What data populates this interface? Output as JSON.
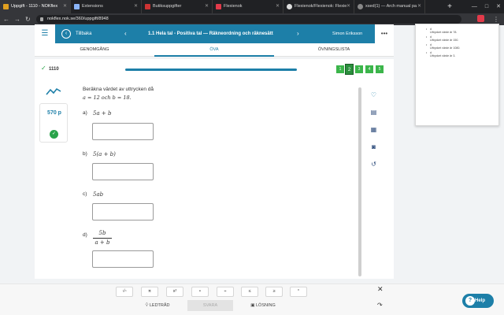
{
  "browser": {
    "tabs": [
      {
        "title": "Uppgift - 1110 - NOKflex",
        "color": "#e0a020",
        "active": true
      },
      {
        "title": "Extensions",
        "color": "#8ab4f8",
        "active": false
      },
      {
        "title": "Butiksuppgifter",
        "color": "#cc3333",
        "active": false
      },
      {
        "title": "Flexienok",
        "color": "#e23a4a",
        "active": false
      },
      {
        "title": "Flexienok/Flexienok: Flexie",
        "color": "#dddddd",
        "active": false
      },
      {
        "title": "xsed(1) — Arch manual pa",
        "color": "#888888",
        "active": false
      }
    ],
    "new_tab": "+",
    "url": "nokflex.nok.se/360/uppgift/8948",
    "window_controls": [
      "—",
      "□",
      "✕"
    ]
  },
  "header": {
    "back_label": "Tillbaka",
    "chapter_title": "1.1 Hela tal - Positiva tal — Räkneordning och räknesätt",
    "user_name": "Simon Eriksson"
  },
  "mode_tabs": [
    {
      "label": "GENOMGÅNG",
      "active": false
    },
    {
      "label": "ÖVA",
      "active": true
    },
    {
      "label": "ÖVNINGSLISTA",
      "active": false
    }
  ],
  "task": {
    "number": "1110",
    "progress": [
      "1",
      "2",
      "3",
      "4",
      "5"
    ],
    "current": 2
  },
  "points": {
    "label": "570 p"
  },
  "question": {
    "instruction": "Beräkna värdet av uttrycken då",
    "values": "a = 12 och b = 18.",
    "parts": [
      {
        "label": "a)",
        "expr": "5a + b",
        "answer": ""
      },
      {
        "label": "b)",
        "expr": "5(a + b)",
        "answer": ""
      },
      {
        "label": "c)",
        "expr": "5ab",
        "answer": ""
      },
      {
        "label": "d)",
        "numerator": "5b",
        "denominator": "a + b",
        "answer": ""
      }
    ]
  },
  "math_toolbar": [
    "√▫",
    "π",
    "x²",
    "•",
    "÷",
    "≤",
    "≥",
    "°"
  ],
  "actions": {
    "hint": "LEDTRÅD",
    "submit": "SVARA",
    "solution": "LÖSNING"
  },
  "help": {
    "label": "Help"
  },
  "extension_popup": {
    "items": [
      {
        "line1": "d",
        "line2": "Uttrycket värde är 78."
      },
      {
        "line1": "d",
        "line2": "Uttrycket värde är 150."
      },
      {
        "line1": "d",
        "line2": "Uttrycket värde är 1080."
      },
      {
        "line1": "d",
        "line2": "Uttrycket värde är 3."
      }
    ]
  },
  "colors": {
    "brand": "#1d7fa8",
    "success": "#3bb54a",
    "help": "#1d7fa8"
  }
}
